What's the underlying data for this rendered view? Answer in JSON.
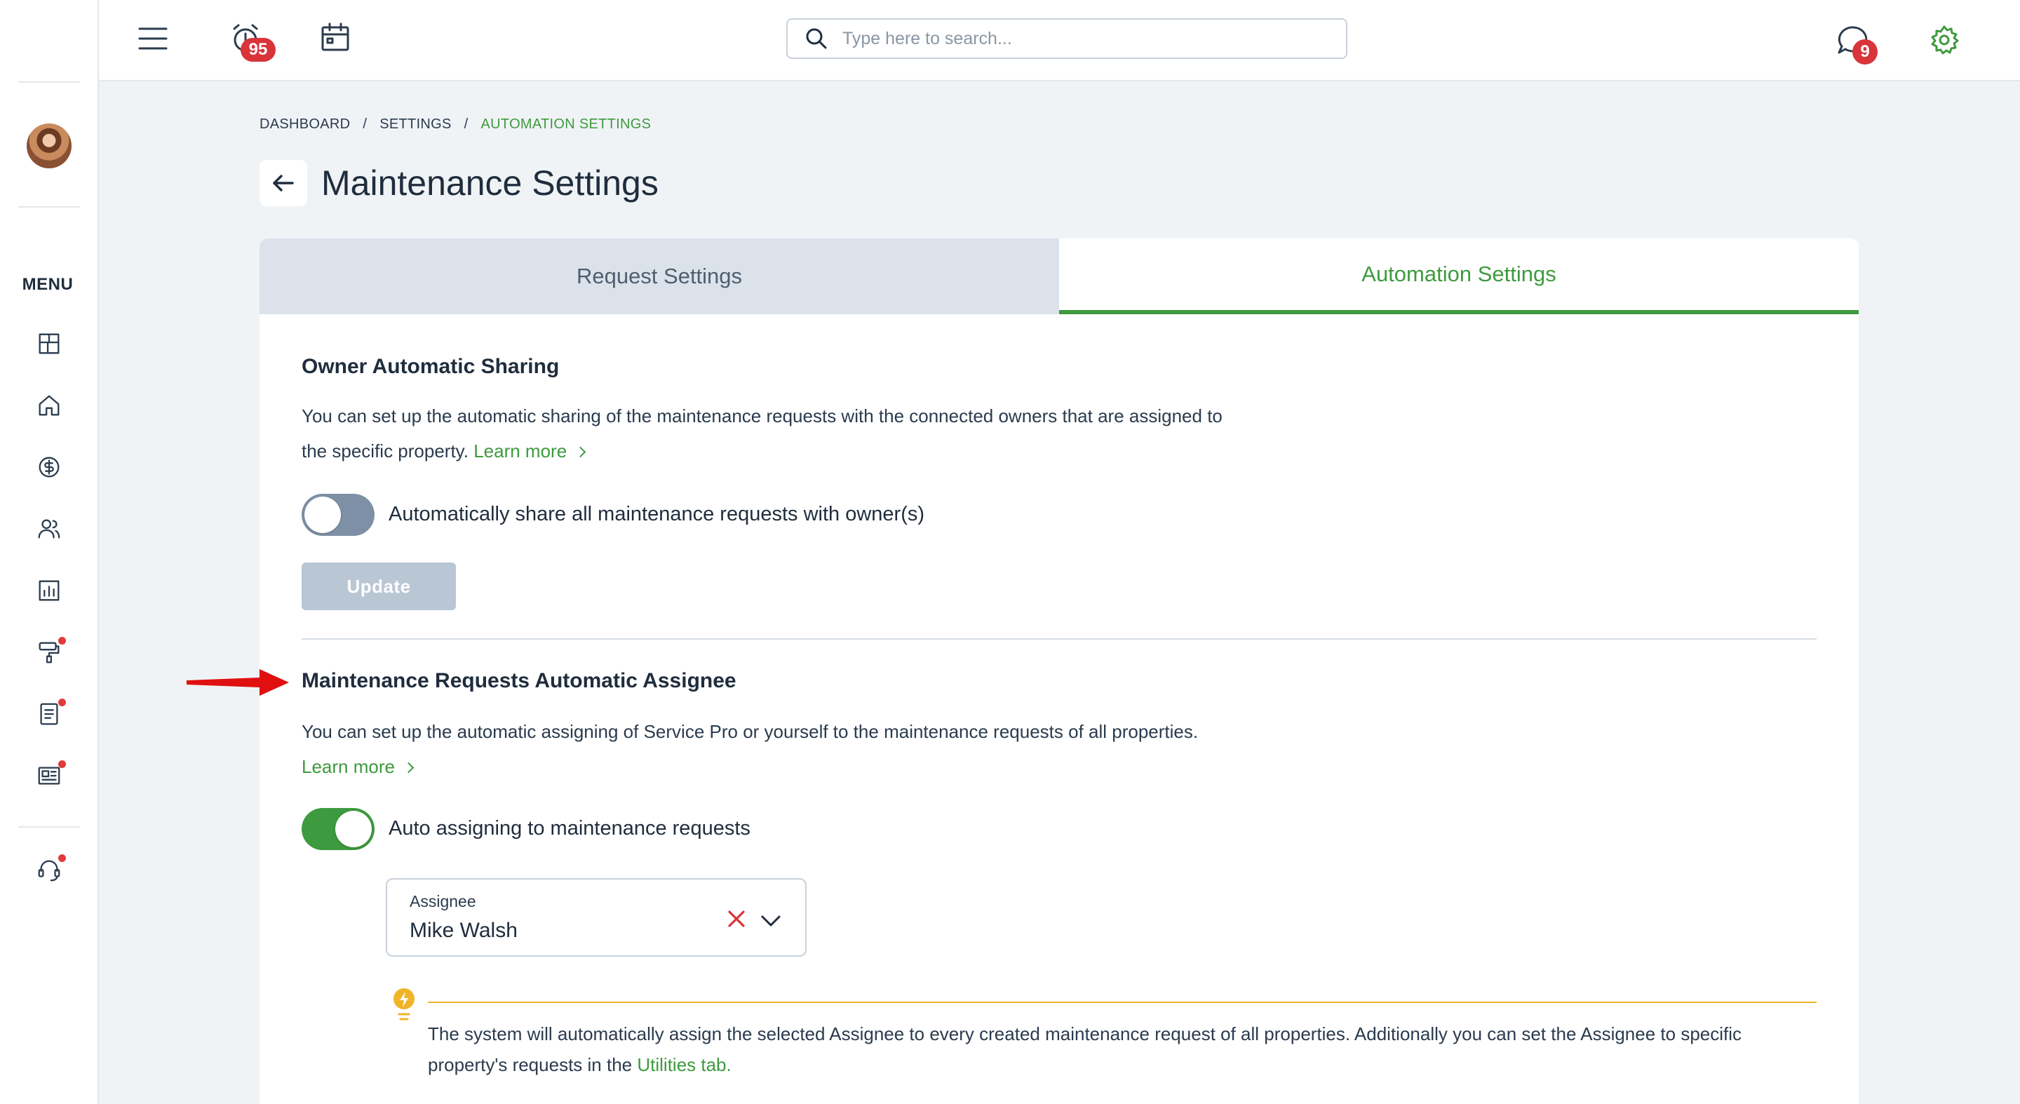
{
  "topbar": {
    "alarm_badge": "95",
    "messages_badge": "9",
    "search_placeholder": "Type here to search..."
  },
  "sidebar": {
    "menu_label": "MENU",
    "items": [
      {
        "icon": "dashboard-icon"
      },
      {
        "icon": "home-icon"
      },
      {
        "icon": "dollar-icon"
      },
      {
        "icon": "users-icon"
      },
      {
        "icon": "reports-icon"
      },
      {
        "icon": "paint-roller-icon"
      },
      {
        "icon": "document-icon"
      },
      {
        "icon": "news-icon"
      },
      {
        "icon": "support-icon"
      }
    ]
  },
  "breadcrumb": {
    "items": [
      "DASHBOARD",
      "SETTINGS",
      "AUTOMATION SETTINGS"
    ],
    "separator": "/"
  },
  "page": {
    "title": "Maintenance Settings"
  },
  "tabs": [
    {
      "label": "Request Settings",
      "active": false
    },
    {
      "label": "Automation Settings",
      "active": true
    }
  ],
  "owner_sharing": {
    "title": "Owner Automatic Sharing",
    "description_line1": "You can set up the automatic sharing of the maintenance requests with the connected owners that are assigned to",
    "description_line2": "the specific property.",
    "learn_more": "Learn more",
    "toggle_label": "Automatically share all maintenance requests with owner(s)",
    "toggle_on": false,
    "update_label": "Update"
  },
  "auto_assignee": {
    "title": "Maintenance Requests Automatic Assignee",
    "description": "You can set up the automatic assigning of Service Pro or yourself to the maintenance requests of all properties.",
    "learn_more": "Learn more",
    "toggle_label": "Auto assigning to maintenance requests",
    "toggle_on": true,
    "assignee_label": "Assignee",
    "assignee_value": "Mike Walsh",
    "tip_text": "The system will automatically assign the selected Assignee to every created maintenance request of all properties. Additionally you can set the Assignee to specific property's requests in the",
    "tip_link": "Utilities tab."
  },
  "colors": {
    "accent_green": "#3e9a3e",
    "badge_red": "#d8343a",
    "annotation_arrow": "#e01010",
    "tip_yellow": "#f0b429"
  }
}
